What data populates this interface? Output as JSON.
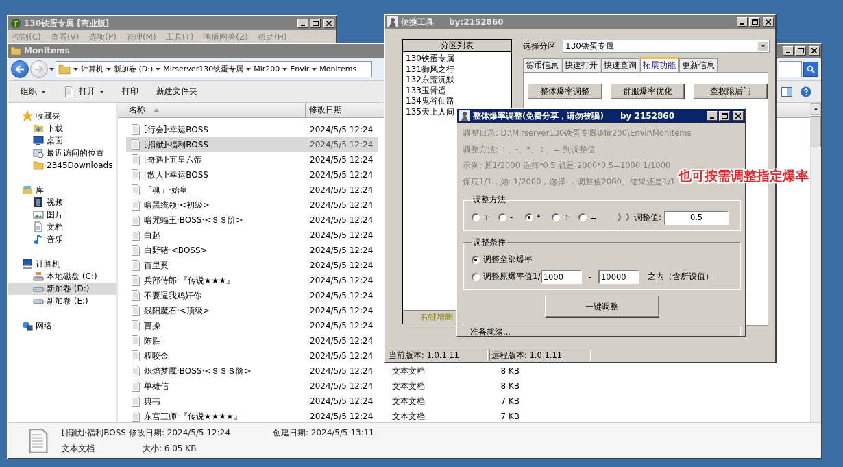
{
  "main_window": {
    "title": "130铁蛋专属 [商业版]",
    "active": false,
    "menu": [
      {
        "label": "控制(C)",
        "disabled": true
      },
      {
        "label": "查看(V)",
        "disabled": true
      },
      {
        "label": "选项(P)",
        "disabled": true
      },
      {
        "label": "管理(M)",
        "disabled": true
      },
      {
        "label": "工具(T)",
        "disabled": true
      },
      {
        "label": "鸿盾网关(Z)",
        "disabled": true
      },
      {
        "label": "帮助(H)",
        "disabled": true
      }
    ]
  },
  "explorer": {
    "title": "MonItems",
    "active": false,
    "breadcrumb": [
      "计算机",
      "新加卷 (D:)",
      "Mirserver130铁蛋专属",
      "Mir200",
      "Envir",
      "MonItems"
    ],
    "toolbar": [
      {
        "label": "组织",
        "kind": "menu"
      },
      {
        "label": "打开",
        "kind": "split"
      },
      {
        "label": "打印",
        "kind": "plain"
      },
      {
        "label": "新建文件夹",
        "kind": "plain"
      }
    ],
    "nav": [
      {
        "label": "收藏夹",
        "kind": "star",
        "selected": false,
        "children": [
          {
            "label": "下载",
            "kind": "download",
            "selected": false
          },
          {
            "label": "桌面",
            "kind": "desktop",
            "selected": false
          },
          {
            "label": "最近访问的位置",
            "kind": "recent",
            "selected": false
          },
          {
            "label": "2345Downloads",
            "kind": "folder",
            "selected": false
          }
        ]
      },
      {
        "label": "库",
        "kind": "library",
        "selected": false,
        "children": [
          {
            "label": "视频",
            "kind": "video",
            "selected": false
          },
          {
            "label": "图片",
            "kind": "picture",
            "selected": false
          },
          {
            "label": "文档",
            "kind": "document",
            "selected": false
          },
          {
            "label": "音乐",
            "kind": "music",
            "selected": false
          }
        ]
      },
      {
        "label": "计算机",
        "kind": "computer",
        "selected": false,
        "children": [
          {
            "label": "本地磁盘 (C:)",
            "kind": "system-drive",
            "selected": false
          },
          {
            "label": "新加卷 (D:)",
            "kind": "drive",
            "selected": true
          },
          {
            "label": "新加卷 (E:)",
            "kind": "drive",
            "selected": false
          }
        ]
      },
      {
        "label": "网络",
        "kind": "network",
        "selected": false
      }
    ],
    "columns": [
      {
        "label": "名称",
        "sorted": true
      },
      {
        "label": "修改日期",
        "sorted": false
      }
    ],
    "files": [
      {
        "name": "[行会]·幸运BOSS",
        "modified": "2024/5/5 12:24",
        "selected": false
      },
      {
        "name": "[捐献]·福利BOSS",
        "modified": "2024/5/5 12:24",
        "selected": true
      },
      {
        "name": "[奇遇]·五皇六帝",
        "modified": "2024/5/5 12:24",
        "selected": false
      },
      {
        "name": "[散人]·幸运BOSS",
        "modified": "2024/5/5 12:24",
        "selected": false
      },
      {
        "name": "「魂」·始皇",
        "modified": "2024/5/5 12:24",
        "selected": false
      },
      {
        "name": "暗黑统领·<初级>",
        "modified": "2024/5/5 12:24",
        "selected": false
      },
      {
        "name": "暗咒蝠王·BOSS·<ＳＳ阶>",
        "modified": "2024/5/5 12:24",
        "selected": false
      },
      {
        "name": "白起",
        "modified": "2024/5/5 12:24",
        "selected": false
      },
      {
        "name": "白野猪·<BOSS>",
        "modified": "2024/5/5 12:24",
        "selected": false
      },
      {
        "name": "百里奚",
        "modified": "2024/5/5 12:24",
        "selected": false
      },
      {
        "name": "兵部侍郎·『传说★★★』",
        "modified": "2024/5/5 12:24",
        "selected": false
      },
      {
        "name": "不要逼我鸡奸你",
        "modified": "2024/5/5 12:24",
        "selected": false
      },
      {
        "name": "残阳魔石·<顶级>",
        "modified": "2024/5/5 12:24",
        "selected": false
      },
      {
        "name": "曹操",
        "modified": "2024/5/5 12:24",
        "selected": false
      },
      {
        "name": "陈胜",
        "modified": "2024/5/5 12:24",
        "selected": false
      },
      {
        "name": "程咬金",
        "modified": "2024/5/5 12:24",
        "selected": false
      },
      {
        "name": "炽焰梦魇·BOSS·<ＳＳＳ阶>",
        "modified": "2024/5/5 12:24",
        "type": "文本文档",
        "size": "8 KB",
        "selected": false
      },
      {
        "name": "单雄信",
        "modified": "2024/5/5 12:24",
        "type": "文本文档",
        "size": "8 KB",
        "selected": false
      },
      {
        "name": "典韦",
        "modified": "2024/5/5 12:24",
        "type": "文本文档",
        "size": "7 KB",
        "selected": false
      },
      {
        "name": "东宫三师·『传说★★★★』",
        "modified": "2024/5/5 12:24",
        "type": "文本文档",
        "size": "7 KB",
        "selected": false
      }
    ],
    "details": {
      "name": "[捐献]·福利BOSS",
      "modified": "修改日期: 2024/5/5 12:24",
      "created": "创建日期: 2024/5/5 13:11",
      "type": "文本文档",
      "size": "大小: 6.05 KB"
    }
  },
  "tool_window": {
    "title": "便捷工具",
    "author": "by:2152860",
    "active": false,
    "list_header": "分区列表",
    "partitions": [
      "130铁蛋专属",
      "131御风之行",
      "132东荒沉默",
      "133玉骨遥",
      "134鬼谷仙路",
      "135天上人间"
    ],
    "list_footer": "右键增删",
    "select_label": "选择分区",
    "select_value": "130铁蛋专属",
    "tabs": [
      {
        "label": "货币信息",
        "selected": false
      },
      {
        "label": "快速打开",
        "selected": false
      },
      {
        "label": "快速查询",
        "selected": false
      },
      {
        "label": "拓展功能",
        "selected": true
      },
      {
        "label": "更新信息",
        "selected": false
      }
    ],
    "actions": [
      "整体爆率调整",
      "群服爆率优化",
      "查权限后门"
    ],
    "status": [
      "当前版本: 1.0.1.11",
      "远程版本: 1.0.1.11"
    ]
  },
  "dialog": {
    "title": "整体爆率调整(免费分享，请勿被骗)",
    "author": "by 2152860",
    "active": true,
    "info": [
      {
        "text": "调整目录: D:\\Mirserver130铁蛋专属\\Mir200\\Envir\\MonItems",
        "disabled": true
      },
      {
        "text": "调整方法: +、-、*、÷、=  到调整值",
        "disabled": true
      },
      {
        "text": "示例: 原1/2000 选择*0.5 就是 2000*0.5=1000  1/1000",
        "disabled": true
      },
      {
        "text": "保底1/1，如: 1/2000，选择-，调整值2000。结果还是1/1",
        "disabled": true
      }
    ],
    "method_group": "调整方法",
    "methods": [
      {
        "label": "+",
        "selected": false
      },
      {
        "label": "-",
        "selected": false
      },
      {
        "label": "*",
        "selected": true
      },
      {
        "label": "÷",
        "selected": false
      },
      {
        "label": "=",
        "selected": false
      }
    ],
    "value_label": "》》调整值:",
    "value": "0.5",
    "condition_group": "调整条件",
    "conditions": [
      {
        "label": "调整全部爆率",
        "kind": "plain",
        "selected": true
      },
      {
        "label": "调整原爆率值1/",
        "kind": "range",
        "selected": false
      }
    ],
    "range_from": "1000",
    "range_sep": "-",
    "range_to": "10000",
    "range_note": "之内（含所设值）",
    "submit": "一键调整",
    "status": "准备就绪..."
  },
  "annotation": "也可按需调整指定爆率"
}
